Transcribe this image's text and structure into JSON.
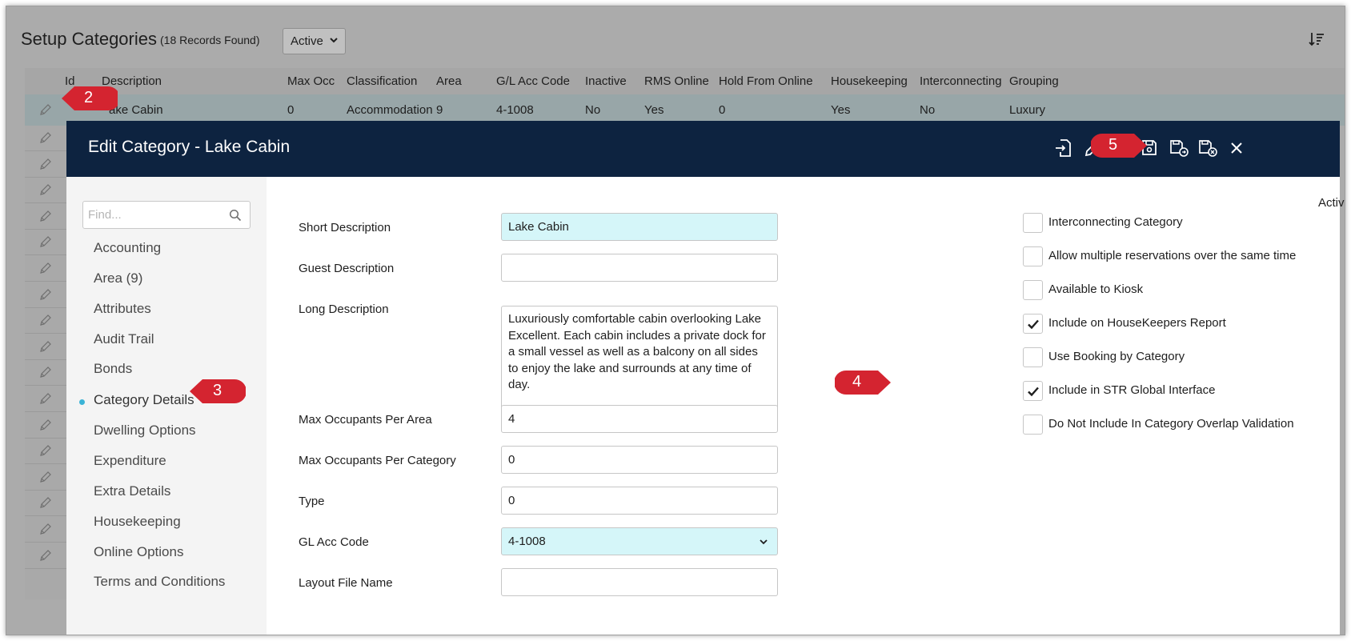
{
  "page": {
    "title": "Setup Categories",
    "records_found": "(18 Records Found)",
    "status_filter": "Active"
  },
  "grid": {
    "columns": [
      "Id",
      "Description",
      "Max Occ",
      "Classification",
      "Area",
      "G/L Acc Code",
      "Inactive",
      "RMS Online",
      "Hold From Online",
      "Housekeeping",
      "Interconnecting",
      "Grouping"
    ],
    "row1": {
      "description": "ake Cabin",
      "max_occ": "0",
      "classification": "Accommodation",
      "area": "9",
      "gl_acc_code": "4-1008",
      "inactive": "No",
      "rms_online": "Yes",
      "hold_from_online": "0",
      "housekeeping": "Yes",
      "interconnecting": "No",
      "grouping": "Luxury"
    }
  },
  "modal": {
    "title": "Edit Category - Lake Cabin",
    "find_placeholder": "Find...",
    "nav": [
      "Accounting",
      "Area (9)",
      "Attributes",
      "Audit Trail",
      "Bonds",
      "Category Details",
      "Dwelling Options",
      "Expenditure",
      "Extra Details",
      "Housekeeping",
      "Online Options",
      "Terms and Conditions"
    ],
    "active_nav_index": 5,
    "active_toggle_label": "Active",
    "active_toggle_on": true,
    "fields": {
      "short_description_label": "Short Description",
      "short_description_value": "Lake Cabin",
      "guest_description_label": "Guest Description",
      "guest_description_value": "",
      "long_description_label": "Long Description",
      "long_description_value": "Luxuriously comfortable cabin overlooking Lake Excellent. Each cabin includes a private dock for a small vessel as well as a balcony on all sides to enjoy the lake and surrounds at any time of day.",
      "max_occ_area_label": "Max Occupants Per Area",
      "max_occ_area_value": "4",
      "max_occ_category_label": "Max Occupants Per Category",
      "max_occ_category_value": "0",
      "type_label": "Type",
      "type_value": "0",
      "gl_acc_label": "GL Acc Code",
      "gl_acc_value": "4-1008",
      "layout_file_label": "Layout File Name",
      "layout_file_value": ""
    },
    "checkboxes": [
      {
        "label": "Interconnecting Category",
        "checked": false
      },
      {
        "label": "Allow multiple reservations over the same time",
        "checked": false
      },
      {
        "label": "Available to Kiosk",
        "checked": false
      },
      {
        "label": "Include on HouseKeepers Report",
        "checked": true
      },
      {
        "label": "Use Booking by Category",
        "checked": false
      },
      {
        "label": "Include in STR Global Interface",
        "checked": true
      },
      {
        "label": "Do Not Include In Category Overlap Validation",
        "checked": false
      }
    ]
  },
  "callouts": {
    "c2": "2",
    "c3": "3",
    "c4": "4",
    "c5": "5"
  },
  "colors": {
    "modal_header": "#0d2340",
    "highlight_field": "#d5f6f9",
    "toggle_on": "#62b842",
    "callout_red": "#d42430",
    "nav_dot": "#3bb3d6"
  },
  "icons": [
    "sort-icon",
    "pencil-icon",
    "search-icon",
    "import-icon",
    "edit-icon",
    "save-icon",
    "save-close-icon",
    "save-exit-icon",
    "close-icon",
    "checkmark-icon",
    "chevron-down-icon"
  ]
}
